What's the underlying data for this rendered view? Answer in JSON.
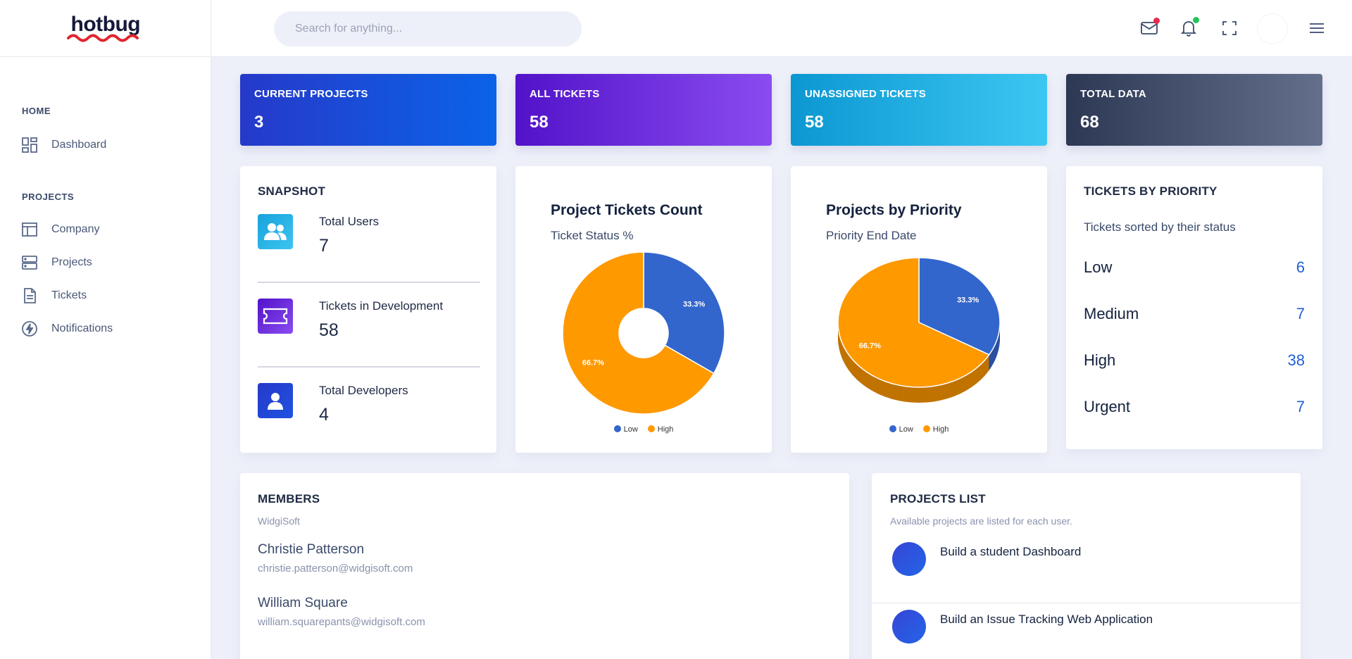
{
  "brand": {
    "name": "hotbug"
  },
  "sidebar": {
    "sections": [
      {
        "title": "HOME",
        "items": [
          {
            "label": "Dashboard",
            "icon": "dashboard-icon"
          }
        ]
      },
      {
        "title": "PROJECTS",
        "items": [
          {
            "label": "Company",
            "icon": "table-icon"
          },
          {
            "label": "Projects",
            "icon": "server-icon"
          },
          {
            "label": "Tickets",
            "icon": "document-icon"
          },
          {
            "label": "Notifications",
            "icon": "bolt-icon"
          }
        ]
      }
    ]
  },
  "header": {
    "search_placeholder": "Search for anything...",
    "icons": [
      "mail-icon",
      "bell-icon",
      "fullscreen-icon",
      "avatar",
      "menu-icon"
    ]
  },
  "stats": [
    {
      "title": "CURRENT PROJECTS",
      "value": "3",
      "colors": [
        "#2639c9",
        "#0b63e8"
      ]
    },
    {
      "title": "ALL TICKETS",
      "value": "58",
      "colors": [
        "#5212c9",
        "#8a4cf0"
      ]
    },
    {
      "title": "UNASSIGNED TICKETS",
      "value": "58",
      "colors": [
        "#0c97d2",
        "#3cc7f2"
      ]
    },
    {
      "title": "TOTAL DATA",
      "value": "68",
      "colors": [
        "#2d3854",
        "#646f8c"
      ]
    }
  ],
  "snapshot": {
    "title": "SNAPSHOT",
    "rows": [
      {
        "label": "Total Users",
        "value": "7",
        "icon": "users-icon"
      },
      {
        "label": "Tickets in Development",
        "value": "58",
        "icon": "ticket-icon"
      },
      {
        "label": "Total Developers",
        "value": "4",
        "icon": "user-icon"
      }
    ]
  },
  "chart_data": [
    {
      "type": "pie",
      "variant": "donut",
      "title": "Project Tickets Count",
      "subtitle": "Ticket Status %",
      "categories": [
        "Low",
        "High"
      ],
      "values": [
        33.3,
        66.7
      ],
      "data_labels": [
        "33.3%",
        "66.7%"
      ],
      "colors": [
        "#3366cc",
        "#ff9900"
      ],
      "legend": "bottom"
    },
    {
      "type": "pie",
      "variant": "3d",
      "title": "Projects by Priority",
      "subtitle": "Priority End Date",
      "categories": [
        "Low",
        "High"
      ],
      "values": [
        33.3,
        66.7
      ],
      "data_labels": [
        "33.3%",
        "66.7%"
      ],
      "colors": [
        "#3366cc",
        "#ff9900"
      ],
      "legend": "bottom"
    }
  ],
  "priority": {
    "title": "TICKETS BY PRIORITY",
    "subtitle": "Tickets sorted by their status",
    "rows": [
      {
        "name": "Low",
        "count": "6"
      },
      {
        "name": "Medium",
        "count": "7"
      },
      {
        "name": "High",
        "count": "38"
      },
      {
        "name": "Urgent",
        "count": "7"
      }
    ]
  },
  "members": {
    "title": "MEMBERS",
    "company": "WidgiSoft",
    "list": [
      {
        "name": "Christie Patterson",
        "email": "christie.patterson@widgisoft.com"
      },
      {
        "name": "William Square",
        "email": "william.squarepants@widgisoft.com"
      }
    ]
  },
  "projects_list": {
    "title": "PROJECTS LIST",
    "subtitle": "Available projects are listed for each user.",
    "items": [
      {
        "name": "Build a student Dashboard"
      },
      {
        "name": "Build an Issue Tracking Web Application"
      }
    ]
  }
}
